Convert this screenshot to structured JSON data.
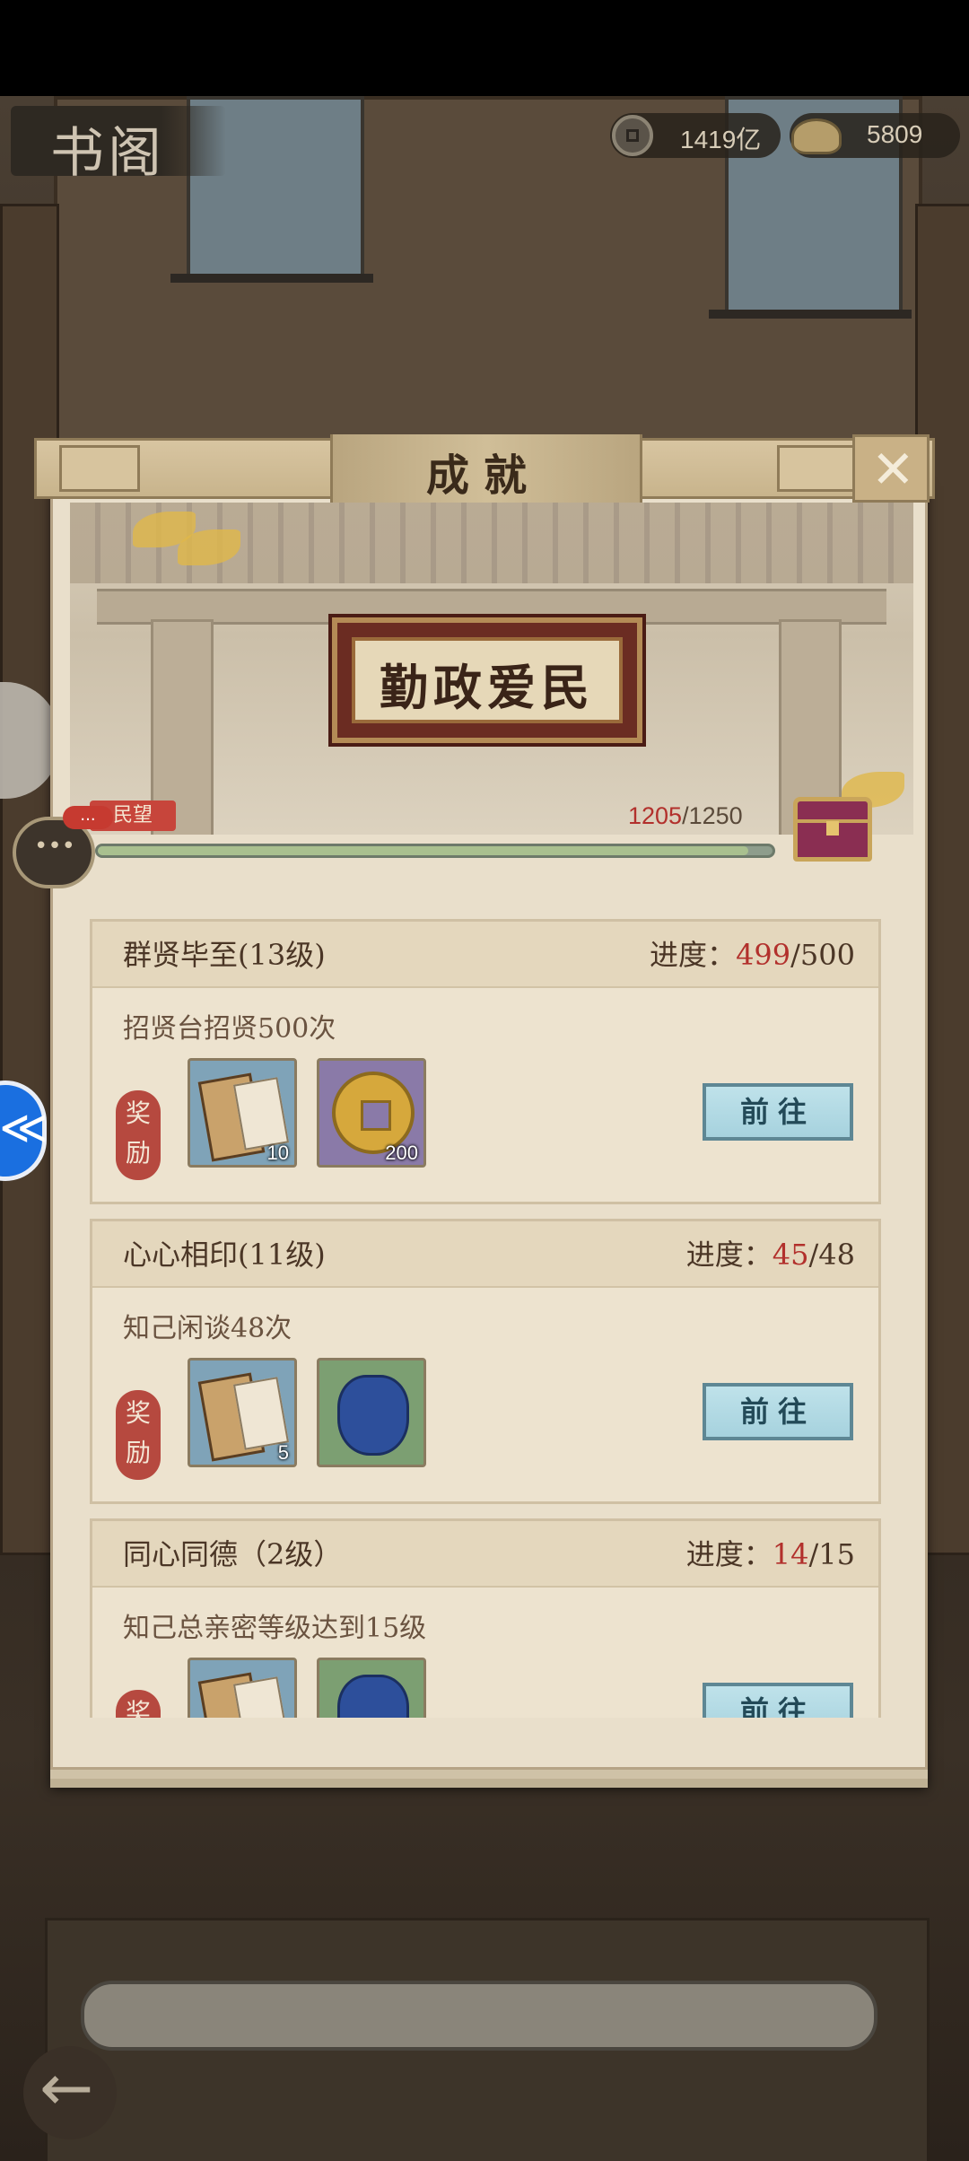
{
  "top_bar": {
    "title": "书阁",
    "resources": [
      {
        "icon": "copper-coin-icon",
        "value": "1419亿"
      },
      {
        "icon": "gold-ingot-icon",
        "value": "5809"
      }
    ]
  },
  "dialog": {
    "title": "成就",
    "close_icon": "close-icon",
    "plaque_text": "勤政爱民",
    "reputation_label": "民望",
    "progress": {
      "current": "1205",
      "separator": "/",
      "total": "1250",
      "fraction": 0.964
    },
    "chest_icon": "treasure-chest-icon"
  },
  "achievements": [
    {
      "title": "群贤毕至(13级)",
      "progress_label": "进度：",
      "current": "499",
      "sep": "/",
      "total": "500",
      "desc": "招贤台招贤500次",
      "reward_label": "奖励",
      "rewards": [
        {
          "icon": "reputation-book-icon",
          "count": "10",
          "color": "blue"
        },
        {
          "icon": "copper-coin-icon",
          "count": "200",
          "color": "purple"
        }
      ],
      "button": "前往"
    },
    {
      "title": "心心相印(11级)",
      "progress_label": "进度：",
      "current": "45",
      "sep": "/",
      "total": "48",
      "desc": "知己闲谈48次",
      "reward_label": "奖励",
      "rewards": [
        {
          "icon": "reputation-book-icon",
          "count": "5",
          "color": "blue"
        },
        {
          "icon": "blue-pouch-icon",
          "count": "",
          "color": "green"
        }
      ],
      "button": "前往"
    },
    {
      "title": "同心同德（2级）",
      "progress_label": "进度：",
      "current": "14",
      "sep": "/",
      "total": "15",
      "desc": "知己总亲密等级达到15级",
      "reward_label": "奖励",
      "rewards": [
        {
          "icon": "reputation-book-icon",
          "count": "",
          "color": "blue"
        },
        {
          "icon": "blue-pouch-icon",
          "count": "",
          "color": "green"
        }
      ],
      "button": "前往"
    }
  ],
  "floating": {
    "chat_icon": "chat-bubble-icon",
    "chat_badge": "...",
    "back_icon": "back-arrow-icon"
  },
  "colors": {
    "accent_red": "#b2302c",
    "button_blue": "#a6d2de",
    "panel_bg": "#e9dfcb"
  }
}
